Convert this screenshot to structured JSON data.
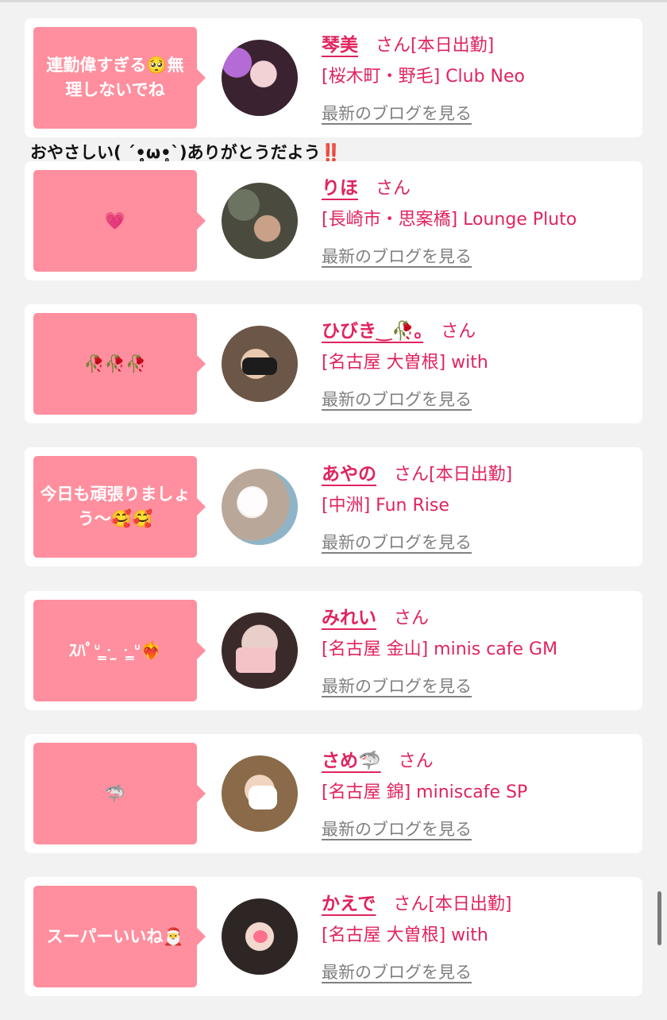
{
  "overlay_caption": "おやさしい( ´•̥̥̥ω•̥̥̥`)ありがとうだよう‼️",
  "suffix": "さん",
  "blog_link": "最新のブログを見る",
  "accent_color": "#e0245e",
  "bubble_color": "#ff8f9e",
  "cards": [
    {
      "message": "連勤偉すぎる🥺無理しないでね",
      "name": "琴美",
      "status": "[本日出勤]",
      "shop": "[桜木町・野毛] Club Neo"
    },
    {
      "message": "💗",
      "name": "りほ",
      "status": "",
      "shop": "[長崎市・思案橋] Lounge Pluto"
    },
    {
      "message": "🥀🥀🥀",
      "name": "ひびき‿🥀｡",
      "status": "",
      "shop": "[名古屋 大曽根] with"
    },
    {
      "message": "今日も頑張りましょう〜🥰🥰",
      "name": "あやの",
      "status": "[本日出勤]",
      "shop": "[中洲] Fun Rise"
    },
    {
      "message": "ｽﾊﾟᐡ ̳ᐧ ̫ ᐧ ̳ᐡ❤️‍🔥",
      "name": "みれい",
      "status": "",
      "shop": "[名古屋 金山] minis cafe GM"
    },
    {
      "message": "🦈",
      "name": "さめ🦈",
      "status": "",
      "shop": "[名古屋 錦] miniscafe SP"
    },
    {
      "message": "スーパーいいね🎅",
      "name": "かえで",
      "status": "[本日出勤]",
      "shop": "[名古屋 大曽根] with"
    }
  ]
}
